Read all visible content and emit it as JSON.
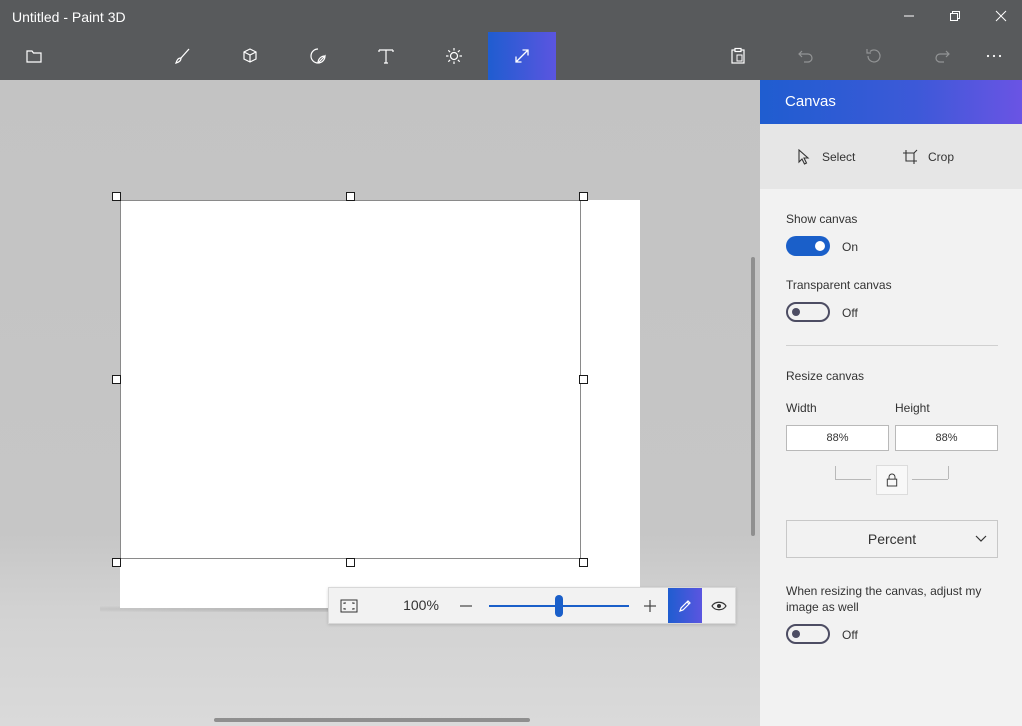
{
  "window": {
    "title": "Untitled - Paint 3D",
    "controls": [
      "minimize",
      "maximize",
      "close"
    ]
  },
  "toolbar": {
    "items": [
      {
        "name": "menu",
        "icon": "folder-icon"
      },
      {
        "name": "brushes",
        "icon": "brush-icon"
      },
      {
        "name": "3d-shapes",
        "icon": "cube-icon"
      },
      {
        "name": "stickers",
        "icon": "sticker-icon"
      },
      {
        "name": "text",
        "icon": "text-icon"
      },
      {
        "name": "effects",
        "icon": "sun-icon"
      },
      {
        "name": "canvas",
        "icon": "resize-canvas-icon",
        "active": true
      },
      {
        "name": "paste",
        "icon": "clipboard-icon"
      },
      {
        "name": "undo",
        "icon": "undo-icon",
        "disabled": true
      },
      {
        "name": "history",
        "icon": "history-icon",
        "disabled": true
      },
      {
        "name": "redo",
        "icon": "redo-icon",
        "disabled": true
      },
      {
        "name": "more",
        "icon": "more-icon"
      }
    ],
    "accent": "#2f5bd6"
  },
  "zoom": {
    "value": "100%",
    "level_fraction": 0.5
  },
  "panel": {
    "title": "Canvas",
    "select_label": "Select",
    "crop_label": "Crop",
    "show_canvas": {
      "label": "Show canvas",
      "state": "On"
    },
    "transparent_canvas": {
      "label": "Transparent canvas",
      "state": "Off"
    },
    "resize": {
      "label": "Resize canvas",
      "width_label": "Width",
      "height_label": "Height",
      "width_value": "88%",
      "height_value": "88%",
      "unit": "Percent"
    },
    "adjust_image": {
      "label": "When resizing the canvas, adjust my image as well",
      "state": "Off"
    }
  }
}
